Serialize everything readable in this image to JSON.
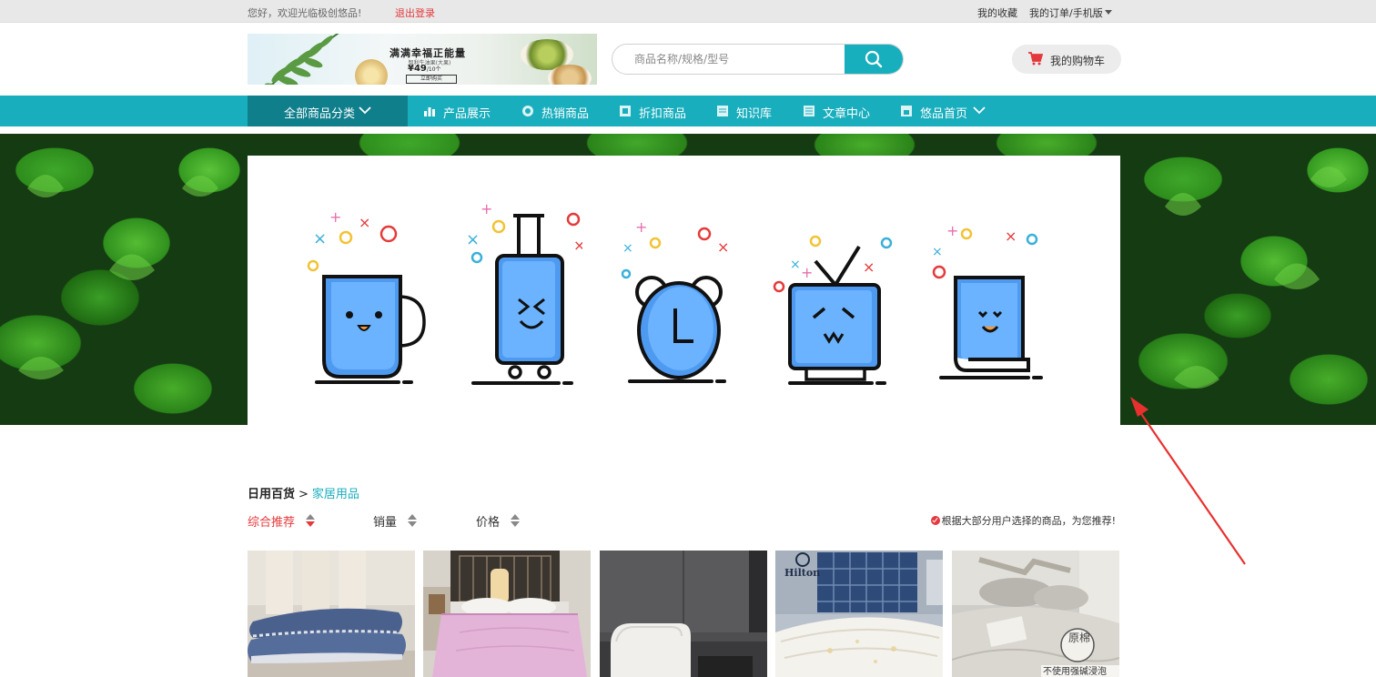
{
  "topbar": {
    "welcome": "您好，欢迎光临极创悠品!",
    "logout": "退出登录",
    "favorites": "我的收藏",
    "orders": "我的订单/手机版"
  },
  "header": {
    "ad": {
      "title": "满满幸福正能量",
      "subtitle": "智利牛油果(大果)",
      "price": "¥49",
      "price_unit": "/10个",
      "button": "立即购买"
    },
    "search": {
      "placeholder": "商品名称/规格/型号"
    },
    "cart": {
      "label": "我的购物车"
    }
  },
  "nav": {
    "category": "全部商品分类",
    "items": [
      {
        "label": "产品展示",
        "icon": "chart-icon"
      },
      {
        "label": "热销商品",
        "icon": "hot-icon"
      },
      {
        "label": "折扣商品",
        "icon": "discount-icon"
      },
      {
        "label": "知识库",
        "icon": "book-icon"
      },
      {
        "label": "文章中心",
        "icon": "article-icon"
      },
      {
        "label": "悠品首页",
        "icon": "home-icon"
      }
    ]
  },
  "hero": {
    "illustrations": [
      "cup-icon",
      "suitcase-icon",
      "alarm-clock-icon",
      "tv-icon",
      "book-icon"
    ]
  },
  "breadcrumb": {
    "parent": "日用百货",
    "separator": ">",
    "current": "家居用品"
  },
  "sort": {
    "items": [
      "综合推荐",
      "销量",
      "价格"
    ],
    "active": "综合推荐",
    "recommend_note": "根据大部分用户选择的商品，为您推荐!"
  },
  "products": [
    {
      "name": "blue-pillow",
      "overlay": ""
    },
    {
      "name": "pink-quilt",
      "overlay": ""
    },
    {
      "name": "white-sofa",
      "overlay": ""
    },
    {
      "name": "hotel-duvet",
      "overlay": "Hilton"
    },
    {
      "name": "cotton-bedding",
      "overlay": "不使用强碱浸泡",
      "stamp": "原棉"
    }
  ],
  "colors": {
    "accent": "#17aebe",
    "accent_dark": "#107f8c",
    "alert": "#e4393c"
  }
}
